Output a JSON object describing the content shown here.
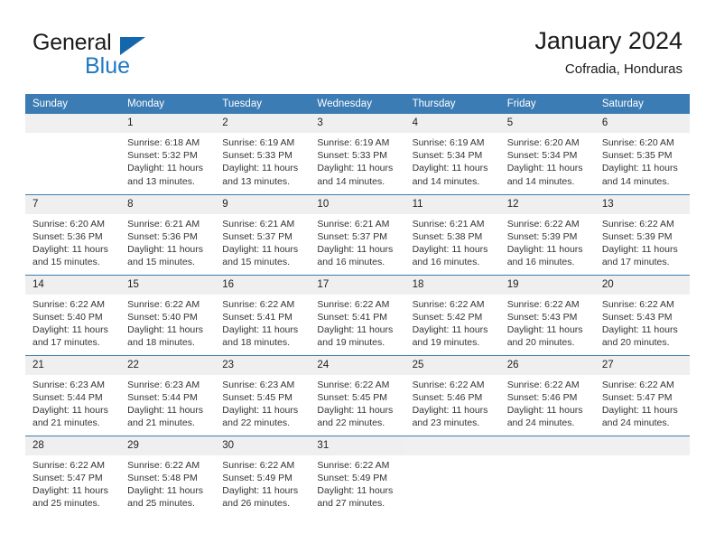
{
  "brand": {
    "name_top": "General",
    "name_bottom": "Blue",
    "accent_color": "#1f78c1",
    "triangle_color": "#1567ad"
  },
  "header": {
    "title": "January 2024",
    "subtitle": "Cofradia, Honduras"
  },
  "calendar": {
    "header_bg": "#3c7cb4",
    "header_text_color": "#ffffff",
    "weekday_headers": [
      "Sunday",
      "Monday",
      "Tuesday",
      "Wednesday",
      "Thursday",
      "Friday",
      "Saturday"
    ],
    "labels": {
      "sunrise_prefix": "Sunrise:",
      "sunset_prefix": "Sunset:",
      "daylight_prefix": "Daylight:"
    },
    "weeks": [
      [
        {
          "day": "",
          "sunrise": "",
          "sunset": "",
          "daylight_1": "",
          "daylight_2": ""
        },
        {
          "day": "1",
          "sunrise": "Sunrise: 6:18 AM",
          "sunset": "Sunset: 5:32 PM",
          "daylight_1": "Daylight: 11 hours",
          "daylight_2": "and 13 minutes."
        },
        {
          "day": "2",
          "sunrise": "Sunrise: 6:19 AM",
          "sunset": "Sunset: 5:33 PM",
          "daylight_1": "Daylight: 11 hours",
          "daylight_2": "and 13 minutes."
        },
        {
          "day": "3",
          "sunrise": "Sunrise: 6:19 AM",
          "sunset": "Sunset: 5:33 PM",
          "daylight_1": "Daylight: 11 hours",
          "daylight_2": "and 14 minutes."
        },
        {
          "day": "4",
          "sunrise": "Sunrise: 6:19 AM",
          "sunset": "Sunset: 5:34 PM",
          "daylight_1": "Daylight: 11 hours",
          "daylight_2": "and 14 minutes."
        },
        {
          "day": "5",
          "sunrise": "Sunrise: 6:20 AM",
          "sunset": "Sunset: 5:34 PM",
          "daylight_1": "Daylight: 11 hours",
          "daylight_2": "and 14 minutes."
        },
        {
          "day": "6",
          "sunrise": "Sunrise: 6:20 AM",
          "sunset": "Sunset: 5:35 PM",
          "daylight_1": "Daylight: 11 hours",
          "daylight_2": "and 14 minutes."
        }
      ],
      [
        {
          "day": "7",
          "sunrise": "Sunrise: 6:20 AM",
          "sunset": "Sunset: 5:36 PM",
          "daylight_1": "Daylight: 11 hours",
          "daylight_2": "and 15 minutes."
        },
        {
          "day": "8",
          "sunrise": "Sunrise: 6:21 AM",
          "sunset": "Sunset: 5:36 PM",
          "daylight_1": "Daylight: 11 hours",
          "daylight_2": "and 15 minutes."
        },
        {
          "day": "9",
          "sunrise": "Sunrise: 6:21 AM",
          "sunset": "Sunset: 5:37 PM",
          "daylight_1": "Daylight: 11 hours",
          "daylight_2": "and 15 minutes."
        },
        {
          "day": "10",
          "sunrise": "Sunrise: 6:21 AM",
          "sunset": "Sunset: 5:37 PM",
          "daylight_1": "Daylight: 11 hours",
          "daylight_2": "and 16 minutes."
        },
        {
          "day": "11",
          "sunrise": "Sunrise: 6:21 AM",
          "sunset": "Sunset: 5:38 PM",
          "daylight_1": "Daylight: 11 hours",
          "daylight_2": "and 16 minutes."
        },
        {
          "day": "12",
          "sunrise": "Sunrise: 6:22 AM",
          "sunset": "Sunset: 5:39 PM",
          "daylight_1": "Daylight: 11 hours",
          "daylight_2": "and 16 minutes."
        },
        {
          "day": "13",
          "sunrise": "Sunrise: 6:22 AM",
          "sunset": "Sunset: 5:39 PM",
          "daylight_1": "Daylight: 11 hours",
          "daylight_2": "and 17 minutes."
        }
      ],
      [
        {
          "day": "14",
          "sunrise": "Sunrise: 6:22 AM",
          "sunset": "Sunset: 5:40 PM",
          "daylight_1": "Daylight: 11 hours",
          "daylight_2": "and 17 minutes."
        },
        {
          "day": "15",
          "sunrise": "Sunrise: 6:22 AM",
          "sunset": "Sunset: 5:40 PM",
          "daylight_1": "Daylight: 11 hours",
          "daylight_2": "and 18 minutes."
        },
        {
          "day": "16",
          "sunrise": "Sunrise: 6:22 AM",
          "sunset": "Sunset: 5:41 PM",
          "daylight_1": "Daylight: 11 hours",
          "daylight_2": "and 18 minutes."
        },
        {
          "day": "17",
          "sunrise": "Sunrise: 6:22 AM",
          "sunset": "Sunset: 5:41 PM",
          "daylight_1": "Daylight: 11 hours",
          "daylight_2": "and 19 minutes."
        },
        {
          "day": "18",
          "sunrise": "Sunrise: 6:22 AM",
          "sunset": "Sunset: 5:42 PM",
          "daylight_1": "Daylight: 11 hours",
          "daylight_2": "and 19 minutes."
        },
        {
          "day": "19",
          "sunrise": "Sunrise: 6:22 AM",
          "sunset": "Sunset: 5:43 PM",
          "daylight_1": "Daylight: 11 hours",
          "daylight_2": "and 20 minutes."
        },
        {
          "day": "20",
          "sunrise": "Sunrise: 6:22 AM",
          "sunset": "Sunset: 5:43 PM",
          "daylight_1": "Daylight: 11 hours",
          "daylight_2": "and 20 minutes."
        }
      ],
      [
        {
          "day": "21",
          "sunrise": "Sunrise: 6:23 AM",
          "sunset": "Sunset: 5:44 PM",
          "daylight_1": "Daylight: 11 hours",
          "daylight_2": "and 21 minutes."
        },
        {
          "day": "22",
          "sunrise": "Sunrise: 6:23 AM",
          "sunset": "Sunset: 5:44 PM",
          "daylight_1": "Daylight: 11 hours",
          "daylight_2": "and 21 minutes."
        },
        {
          "day": "23",
          "sunrise": "Sunrise: 6:23 AM",
          "sunset": "Sunset: 5:45 PM",
          "daylight_1": "Daylight: 11 hours",
          "daylight_2": "and 22 minutes."
        },
        {
          "day": "24",
          "sunrise": "Sunrise: 6:22 AM",
          "sunset": "Sunset: 5:45 PM",
          "daylight_1": "Daylight: 11 hours",
          "daylight_2": "and 22 minutes."
        },
        {
          "day": "25",
          "sunrise": "Sunrise: 6:22 AM",
          "sunset": "Sunset: 5:46 PM",
          "daylight_1": "Daylight: 11 hours",
          "daylight_2": "and 23 minutes."
        },
        {
          "day": "26",
          "sunrise": "Sunrise: 6:22 AM",
          "sunset": "Sunset: 5:46 PM",
          "daylight_1": "Daylight: 11 hours",
          "daylight_2": "and 24 minutes."
        },
        {
          "day": "27",
          "sunrise": "Sunrise: 6:22 AM",
          "sunset": "Sunset: 5:47 PM",
          "daylight_1": "Daylight: 11 hours",
          "daylight_2": "and 24 minutes."
        }
      ],
      [
        {
          "day": "28",
          "sunrise": "Sunrise: 6:22 AM",
          "sunset": "Sunset: 5:47 PM",
          "daylight_1": "Daylight: 11 hours",
          "daylight_2": "and 25 minutes."
        },
        {
          "day": "29",
          "sunrise": "Sunrise: 6:22 AM",
          "sunset": "Sunset: 5:48 PM",
          "daylight_1": "Daylight: 11 hours",
          "daylight_2": "and 25 minutes."
        },
        {
          "day": "30",
          "sunrise": "Sunrise: 6:22 AM",
          "sunset": "Sunset: 5:49 PM",
          "daylight_1": "Daylight: 11 hours",
          "daylight_2": "and 26 minutes."
        },
        {
          "day": "31",
          "sunrise": "Sunrise: 6:22 AM",
          "sunset": "Sunset: 5:49 PM",
          "daylight_1": "Daylight: 11 hours",
          "daylight_2": "and 27 minutes."
        },
        {
          "day": "",
          "sunrise": "",
          "sunset": "",
          "daylight_1": "",
          "daylight_2": ""
        },
        {
          "day": "",
          "sunrise": "",
          "sunset": "",
          "daylight_1": "",
          "daylight_2": ""
        },
        {
          "day": "",
          "sunrise": "",
          "sunset": "",
          "daylight_1": "",
          "daylight_2": ""
        }
      ]
    ]
  }
}
